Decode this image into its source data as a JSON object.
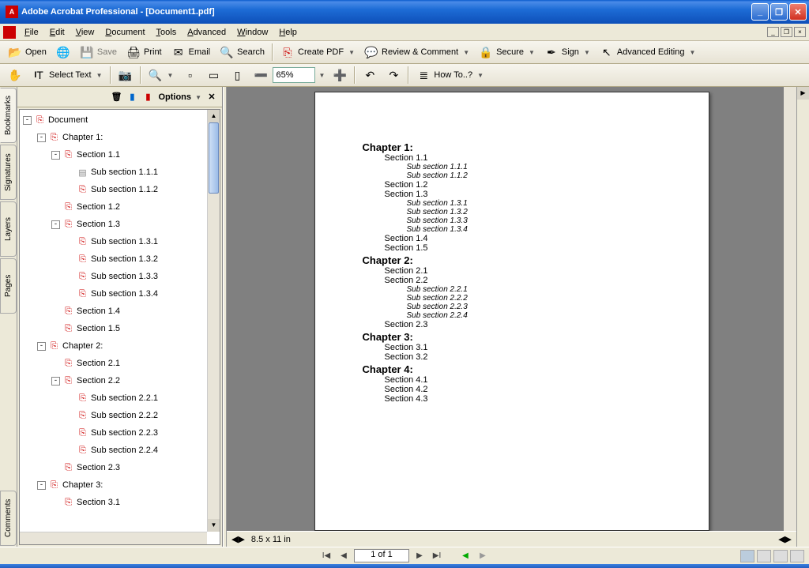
{
  "title": "Adobe Acrobat Professional - [Document1.pdf]",
  "menus": [
    "File",
    "Edit",
    "View",
    "Document",
    "Tools",
    "Advanced",
    "Window",
    "Help"
  ],
  "toolbar1": {
    "open": "Open",
    "save": "Save",
    "print": "Print",
    "email": "Email",
    "search": "Search",
    "createpdf": "Create PDF",
    "review": "Review & Comment",
    "secure": "Secure",
    "sign": "Sign",
    "advedit": "Advanced Editing"
  },
  "toolbar2": {
    "selecttext": "Select Text",
    "zoom": "65%",
    "howto": "How To..?"
  },
  "sidetabs": {
    "bookmarks": "Bookmarks",
    "signatures": "Signatures",
    "layers": "Layers",
    "pages": "Pages",
    "comments": "Comments"
  },
  "bmheader": {
    "options": "Options"
  },
  "bookmarks": [
    {
      "l": 0,
      "t": "-",
      "i": "pdf",
      "label": "Document"
    },
    {
      "l": 1,
      "t": "-",
      "i": "pdf",
      "label": "Chapter 1:"
    },
    {
      "l": 2,
      "t": "-",
      "i": "pdf",
      "label": "Section 1.1"
    },
    {
      "l": 3,
      "t": "",
      "i": "doc",
      "label": "Sub section 1.1.1"
    },
    {
      "l": 3,
      "t": "",
      "i": "pdf",
      "label": "Sub section 1.1.2"
    },
    {
      "l": 2,
      "t": "",
      "i": "pdf",
      "label": "Section 1.2"
    },
    {
      "l": 2,
      "t": "-",
      "i": "pdf",
      "label": "Section 1.3"
    },
    {
      "l": 3,
      "t": "",
      "i": "pdf",
      "label": "Sub section 1.3.1"
    },
    {
      "l": 3,
      "t": "",
      "i": "pdf",
      "label": "Sub section 1.3.2"
    },
    {
      "l": 3,
      "t": "",
      "i": "pdf",
      "label": "Sub section 1.3.3"
    },
    {
      "l": 3,
      "t": "",
      "i": "pdf",
      "label": "Sub section 1.3.4"
    },
    {
      "l": 2,
      "t": "",
      "i": "pdf",
      "label": "Section 1.4"
    },
    {
      "l": 2,
      "t": "",
      "i": "pdf",
      "label": "Section 1.5"
    },
    {
      "l": 1,
      "t": "-",
      "i": "pdf",
      "label": "Chapter 2:"
    },
    {
      "l": 2,
      "t": "",
      "i": "pdf",
      "label": "Section 2.1"
    },
    {
      "l": 2,
      "t": "-",
      "i": "pdf",
      "label": "Section 2.2"
    },
    {
      "l": 3,
      "t": "",
      "i": "pdf",
      "label": "Sub section 2.2.1"
    },
    {
      "l": 3,
      "t": "",
      "i": "pdf",
      "label": "Sub section 2.2.2"
    },
    {
      "l": 3,
      "t": "",
      "i": "pdf",
      "label": "Sub section 2.2.3"
    },
    {
      "l": 3,
      "t": "",
      "i": "pdf",
      "label": "Sub section 2.2.4"
    },
    {
      "l": 2,
      "t": "",
      "i": "pdf",
      "label": "Section 2.3"
    },
    {
      "l": 1,
      "t": "-",
      "i": "pdf",
      "label": "Chapter 3:"
    },
    {
      "l": 2,
      "t": "",
      "i": "pdf",
      "label": "Section 3.1"
    }
  ],
  "page_content": [
    {
      "c": "ch",
      "t": "Chapter 1:"
    },
    {
      "c": "sec",
      "t": "Section 1.1"
    },
    {
      "c": "sub",
      "t": "Sub section 1.1.1"
    },
    {
      "c": "sub",
      "t": "Sub section 1.1.2"
    },
    {
      "c": "sec",
      "t": "Section 1.2"
    },
    {
      "c": "sec",
      "t": "Section 1.3"
    },
    {
      "c": "sub",
      "t": "Sub section 1.3.1"
    },
    {
      "c": "sub",
      "t": "Sub section 1.3.2"
    },
    {
      "c": "sub",
      "t": "Sub section 1.3.3"
    },
    {
      "c": "sub",
      "t": "Sub section 1.3.4"
    },
    {
      "c": "sec",
      "t": "Section 1.4"
    },
    {
      "c": "sec",
      "t": "Section 1.5"
    },
    {
      "c": "ch",
      "t": "Chapter 2:"
    },
    {
      "c": "sec",
      "t": "Section 2.1"
    },
    {
      "c": "sec",
      "t": "Section 2.2"
    },
    {
      "c": "sub",
      "t": "Sub section 2.2.1"
    },
    {
      "c": "sub",
      "t": "Sub section 2.2.2"
    },
    {
      "c": "sub",
      "t": "Sub section 2.2.3"
    },
    {
      "c": "sub",
      "t": "Sub section 2.2.4"
    },
    {
      "c": "sec",
      "t": "Section 2.3"
    },
    {
      "c": "ch",
      "t": "Chapter 3:"
    },
    {
      "c": "sec",
      "t": "Section 3.1"
    },
    {
      "c": "sec",
      "t": "Section 3.2"
    },
    {
      "c": "ch",
      "t": "Chapter 4:"
    },
    {
      "c": "sec",
      "t": "Section 4.1"
    },
    {
      "c": "sec",
      "t": "Section 4.2"
    },
    {
      "c": "sec",
      "t": "Section 4.3"
    }
  ],
  "pagesize": "8.5 x 11 in",
  "pagenav": "1 of 1"
}
